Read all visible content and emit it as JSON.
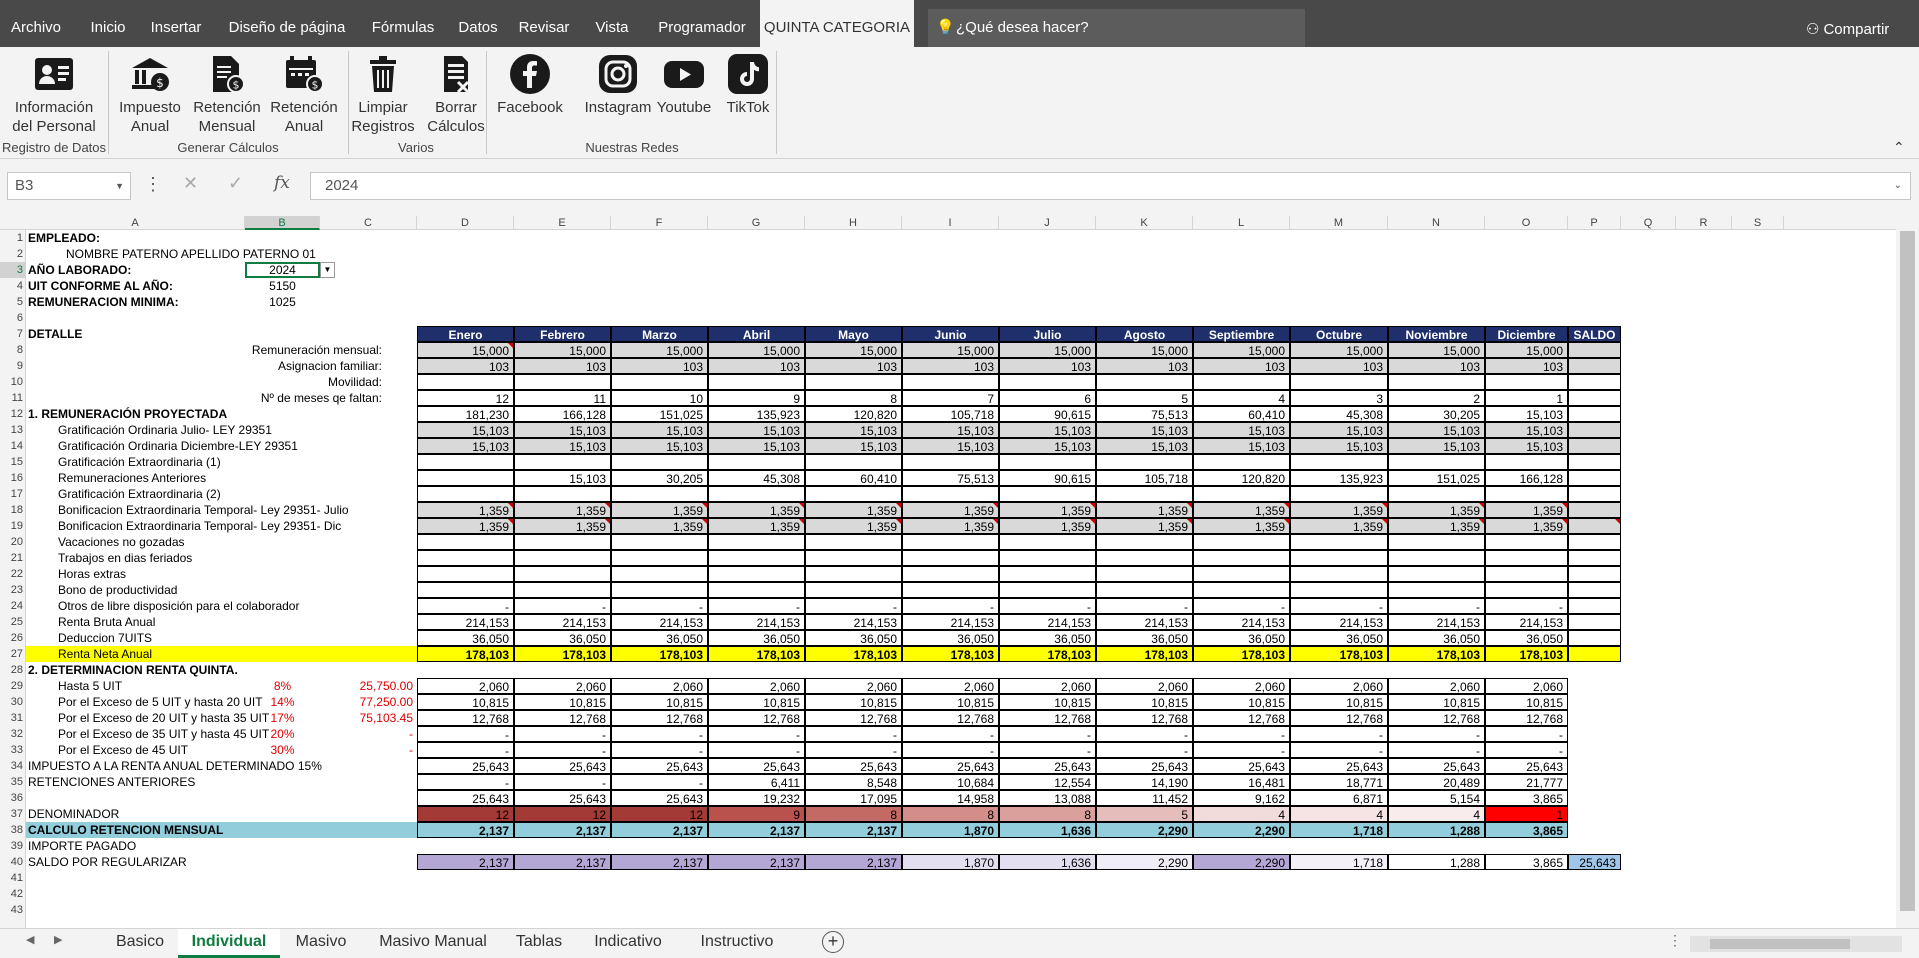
{
  "menu": {
    "items": [
      "Archivo",
      "Inicio",
      "Insertar",
      "Diseño de página",
      "Fórmulas",
      "Datos",
      "Revisar",
      "Vista",
      "Programador",
      "QUINTA CATEGORIA"
    ],
    "search_placeholder": "¿Qué desea hacer?",
    "share": "Compartir"
  },
  "ribbon": {
    "buttons": [
      {
        "line1": "Información",
        "line2": "del Personal",
        "icon": "id-card-icon"
      },
      {
        "line1": "Impuesto",
        "line2": "Anual",
        "icon": "bank-money-icon"
      },
      {
        "line1": "Retención",
        "line2": "Mensual",
        "icon": "document-money-icon"
      },
      {
        "line1": "Retención",
        "line2": "Anual",
        "icon": "calendar-money-icon"
      },
      {
        "line1": "Limpiar",
        "line2": "Registros",
        "icon": "trash-icon"
      },
      {
        "line1": "Borrar",
        "line2": "Cálculos",
        "icon": "clear-sheet-icon"
      },
      {
        "line1": "Facebook",
        "line2": "",
        "icon": "facebook-icon"
      },
      {
        "line1": "Instagram",
        "line2": "",
        "icon": "instagram-icon"
      },
      {
        "line1": "Youtube",
        "line2": "",
        "icon": "youtube-icon"
      },
      {
        "line1": "TikTok",
        "line2": "",
        "icon": "tiktok-icon"
      }
    ],
    "groups": [
      "Registro de Datos",
      "Generar Cálculos",
      "Varios",
      "Nuestras Redes"
    ]
  },
  "formula_bar": {
    "cell_ref": "B3",
    "value": "2024"
  },
  "columns": [
    "A",
    "B",
    "C",
    "D",
    "E",
    "F",
    "G",
    "H",
    "I",
    "J",
    "K",
    "L",
    "M",
    "N",
    "O",
    "P",
    "Q",
    "R",
    "S"
  ],
  "selected_column": "B",
  "selected_row": 3,
  "rows_visible": 43,
  "header": {
    "empleado_label": "EMPLEADO:",
    "empleado_name": "NOMBRE PATERNO APELLIDO PATERNO 01",
    "anio_label": "AÑO LABORADO:",
    "anio_value": "2024",
    "uit_label": "UIT CONFORME AL AÑO:",
    "uit_value": "5150",
    "rem_label": "REMUNERACION MINIMA:",
    "rem_value": "1025",
    "detalle": "DETALLE"
  },
  "months": [
    "Enero",
    "Febrero",
    "Marzo",
    "Abril",
    "Mayo",
    "Junio",
    "Julio",
    "Agosto",
    "Septiembre",
    "Octubre",
    "Noviembre",
    "Diciembre",
    "SALDO"
  ],
  "rows": [
    {
      "row": 8,
      "label": "Remuneración mensual:",
      "align": "right",
      "style": "gray",
      "vals": [
        "15,000",
        "15,000",
        "15,000",
        "15,000",
        "15,000",
        "15,000",
        "15,000",
        "15,000",
        "15,000",
        "15,000",
        "15,000",
        "15,000",
        ""
      ],
      "tri": [
        0
      ]
    },
    {
      "row": 9,
      "label": "Asignacion familiar:",
      "align": "right",
      "style": "gray",
      "vals": [
        "103",
        "103",
        "103",
        "103",
        "103",
        "103",
        "103",
        "103",
        "103",
        "103",
        "103",
        "103",
        ""
      ]
    },
    {
      "row": 10,
      "label": "Movilidad:",
      "align": "right",
      "style": "plain",
      "vals": [
        "",
        "",
        "",
        "",
        "",
        "",
        "",
        "",
        "",
        "",
        "",
        "",
        ""
      ]
    },
    {
      "row": 11,
      "label": "Nº de meses qe faltan:",
      "align": "right",
      "style": "plain",
      "vals": [
        "12",
        "11",
        "10",
        "9",
        "8",
        "7",
        "6",
        "5",
        "4",
        "3",
        "2",
        "1",
        ""
      ]
    },
    {
      "row": 12,
      "label": "1. REMUNERACIÓN PROYECTADA",
      "align": "left",
      "bold": true,
      "style": "plain",
      "vals": [
        "181,230",
        "166,128",
        "151,025",
        "135,923",
        "120,820",
        "105,718",
        "90,615",
        "75,513",
        "60,410",
        "45,308",
        "30,205",
        "15,103",
        ""
      ]
    },
    {
      "row": 13,
      "label": "Gratificación Ordinaria Julio- LEY 29351",
      "align": "indent",
      "style": "gray",
      "vals": [
        "15,103",
        "15,103",
        "15,103",
        "15,103",
        "15,103",
        "15,103",
        "15,103",
        "15,103",
        "15,103",
        "15,103",
        "15,103",
        "15,103",
        ""
      ]
    },
    {
      "row": 14,
      "label": "Gratificación Ordinaria Diciembre-LEY 29351",
      "align": "indent",
      "style": "gray",
      "vals": [
        "15,103",
        "15,103",
        "15,103",
        "15,103",
        "15,103",
        "15,103",
        "15,103",
        "15,103",
        "15,103",
        "15,103",
        "15,103",
        "15,103",
        ""
      ]
    },
    {
      "row": 15,
      "label": "Gratificación Extraordinaria (1)",
      "align": "indent",
      "style": "plain",
      "vals": [
        "",
        "",
        "",
        "",
        "",
        "",
        "",
        "",
        "",
        "",
        "",
        "",
        ""
      ]
    },
    {
      "row": 16,
      "label": "Remuneraciones Anteriores",
      "align": "indent",
      "style": "plain",
      "vals": [
        "",
        "15,103",
        "30,205",
        "45,308",
        "60,410",
        "75,513",
        "90,615",
        "105,718",
        "120,820",
        "135,923",
        "151,025",
        "166,128",
        ""
      ]
    },
    {
      "row": 17,
      "label": "Gratificación Extraordinaria (2)",
      "align": "indent",
      "style": "plain",
      "vals": [
        "",
        "",
        "",
        "",
        "",
        "",
        "",
        "",
        "",
        "",
        "",
        "",
        ""
      ]
    },
    {
      "row": 18,
      "label": "Bonificacion Extraordinaria  Temporal- Ley 29351- Julio",
      "align": "indent",
      "style": "gray",
      "vals": [
        "1,359",
        "1,359",
        "1,359",
        "1,359",
        "1,359",
        "1,359",
        "1,359",
        "1,359",
        "1,359",
        "1,359",
        "1,359",
        "1,359",
        ""
      ],
      "tri": [
        0,
        1,
        2,
        3,
        4,
        5,
        6,
        7,
        8,
        9,
        10,
        11
      ]
    },
    {
      "row": 19,
      "label": "Bonificacion Extraordinaria  Temporal- Ley 29351- Dic",
      "align": "indent",
      "style": "gray",
      "vals": [
        "1,359",
        "1,359",
        "1,359",
        "1,359",
        "1,359",
        "1,359",
        "1,359",
        "1,359",
        "1,359",
        "1,359",
        "1,359",
        "1,359",
        ""
      ],
      "tri": [
        0,
        1,
        2,
        3,
        4,
        5,
        6,
        7,
        8,
        9,
        10,
        11,
        12
      ]
    },
    {
      "row": 20,
      "label": "Vacaciones no gozadas",
      "align": "indent",
      "style": "plain",
      "vals": [
        "",
        "",
        "",
        "",
        "",
        "",
        "",
        "",
        "",
        "",
        "",
        "",
        ""
      ]
    },
    {
      "row": 21,
      "label": "Trabajos en dias feriados",
      "align": "indent",
      "style": "plain",
      "vals": [
        "",
        "",
        "",
        "",
        "",
        "",
        "",
        "",
        "",
        "",
        "",
        "",
        ""
      ]
    },
    {
      "row": 22,
      "label": "Horas extras",
      "align": "indent",
      "style": "plain",
      "vals": [
        "",
        "",
        "",
        "",
        "",
        "",
        "",
        "",
        "",
        "",
        "",
        "",
        ""
      ]
    },
    {
      "row": 23,
      "label": "Bono de productividad",
      "align": "indent",
      "style": "plain",
      "vals": [
        "",
        "",
        "",
        "",
        "",
        "",
        "",
        "",
        "",
        "",
        "",
        "",
        ""
      ]
    },
    {
      "row": 24,
      "label": "Otros de libre disposición para el colaborador",
      "align": "indent",
      "style": "plain",
      "vals": [
        "-",
        "-",
        "-",
        "-",
        "-",
        "-",
        "-",
        "-",
        "-",
        "-",
        "-",
        "-",
        ""
      ]
    },
    {
      "row": 25,
      "label": "Renta Bruta Anual",
      "align": "indent",
      "style": "plain",
      "vals": [
        "214,153",
        "214,153",
        "214,153",
        "214,153",
        "214,153",
        "214,153",
        "214,153",
        "214,153",
        "214,153",
        "214,153",
        "214,153",
        "214,153",
        ""
      ]
    },
    {
      "row": 26,
      "label": "Deduccion  7UITS",
      "align": "indent",
      "style": "plain",
      "vals": [
        "36,050",
        "36,050",
        "36,050",
        "36,050",
        "36,050",
        "36,050",
        "36,050",
        "36,050",
        "36,050",
        "36,050",
        "36,050",
        "36,050",
        ""
      ]
    },
    {
      "row": 27,
      "label": "Renta Neta Anual",
      "align": "indent",
      "style": "yellow",
      "vals": [
        "178,103",
        "178,103",
        "178,103",
        "178,103",
        "178,103",
        "178,103",
        "178,103",
        "178,103",
        "178,103",
        "178,103",
        "178,103",
        "178,103",
        ""
      ]
    }
  ],
  "section2_title": "2. DETERMINACION RENTA QUINTA.",
  "tramos": [
    {
      "row": 29,
      "label": "Hasta 5 UIT",
      "pct": "8%",
      "amt": "25,750.00",
      "vals": [
        "2,060",
        "2,060",
        "2,060",
        "2,060",
        "2,060",
        "2,060",
        "2,060",
        "2,060",
        "2,060",
        "2,060",
        "2,060",
        "2,060"
      ]
    },
    {
      "row": 30,
      "label": "Por el Exceso de 5 UIT y hasta 20 UIT",
      "pct": "14%",
      "amt": "77,250.00",
      "vals": [
        "10,815",
        "10,815",
        "10,815",
        "10,815",
        "10,815",
        "10,815",
        "10,815",
        "10,815",
        "10,815",
        "10,815",
        "10,815",
        "10,815"
      ]
    },
    {
      "row": 31,
      "label": "Por el Exceso de 20 UIT y hasta 35 UIT",
      "pct": "17%",
      "amt": "75,103.45",
      "vals": [
        "12,768",
        "12,768",
        "12,768",
        "12,768",
        "12,768",
        "12,768",
        "12,768",
        "12,768",
        "12,768",
        "12,768",
        "12,768",
        "12,768"
      ]
    },
    {
      "row": 32,
      "label": "Por el Exceso de 35 UIT y hasta 45 UIT",
      "pct": "20%",
      "amt": "-",
      "vals": [
        "-",
        "-",
        "-",
        "-",
        "-",
        "-",
        "-",
        "-",
        "-",
        "-",
        "-",
        "-"
      ]
    },
    {
      "row": 33,
      "label": "Por el Exceso de 45 UIT",
      "pct": "30%",
      "amt": "-",
      "vals": [
        "-",
        "-",
        "-",
        "-",
        "-",
        "-",
        "-",
        "-",
        "-",
        "-",
        "-",
        "-"
      ]
    }
  ],
  "r34": {
    "label": "IMPUESTO A LA RENTA ANUAL DETERMINADO 15%",
    "vals": [
      "25,643",
      "25,643",
      "25,643",
      "25,643",
      "25,643",
      "25,643",
      "25,643",
      "25,643",
      "25,643",
      "25,643",
      "25,643",
      "25,643"
    ]
  },
  "r35": {
    "label": "RETENCIONES ANTERIORES",
    "vals": [
      "-",
      "-",
      "-",
      "6,411",
      "8,548",
      "10,684",
      "12,554",
      "14,190",
      "16,481",
      "18,771",
      "20,489",
      "21,777"
    ]
  },
  "r36": {
    "vals": [
      "25,643",
      "25,643",
      "25,643",
      "19,232",
      "17,095",
      "14,958",
      "13,088",
      "11,452",
      "9,162",
      "6,871",
      "5,154",
      "3,865"
    ]
  },
  "r37": {
    "label": "DENOMINADOR",
    "vals": [
      "12",
      "12",
      "12",
      "9",
      "8",
      "8",
      "8",
      "5",
      "4",
      "4",
      "4",
      "1"
    ],
    "colors": [
      "#a33a35",
      "#a33a35",
      "#a33a35",
      "#b9524c",
      "#c46a64",
      "#d38e89",
      "#d9a09c",
      "#e5bdba",
      "#f2dcdb",
      "#f5e4e3",
      "#f8ecec",
      "#ff0000"
    ]
  },
  "r38": {
    "label": "CALCULO RETENCION MENSUAL",
    "vals": [
      "2,137",
      "2,137",
      "2,137",
      "2,137",
      "2,137",
      "1,870",
      "1,636",
      "2,290",
      "2,290",
      "1,718",
      "1,288",
      "3,865"
    ]
  },
  "r39": {
    "label": "IMPORTE PAGADO"
  },
  "r40": {
    "label": "SALDO POR REGULARIZAR",
    "vals": [
      "2,137",
      "2,137",
      "2,137",
      "2,137",
      "2,137",
      "1,870",
      "1,636",
      "2,290",
      "2,290",
      "1,718",
      "1,288",
      "3,865",
      "25,643"
    ],
    "colors": [
      "#b4a7d6",
      "#b4a7d6",
      "#b4a7d6",
      "#b4a7d6",
      "#b4a7d6",
      "#e4dff0",
      "#e4dff0",
      "#f0edf7",
      "#b4a7d6",
      "#f3f0f8",
      "#ffffff",
      "#ffffff",
      "#9fc5e8"
    ]
  },
  "sheet_tabs": [
    "Basico",
    "Individual",
    "Masivo",
    "Masivo Manual",
    "Tablas",
    "Indicativo",
    "Instructivo"
  ],
  "active_tab": "Individual",
  "colors": {
    "header_navy": "#1f2f6b",
    "gray_cell": "#d9d9d9",
    "yellow": "#ffff00",
    "retention_blue": "#92cddc",
    "excel_green": "#107c41"
  }
}
